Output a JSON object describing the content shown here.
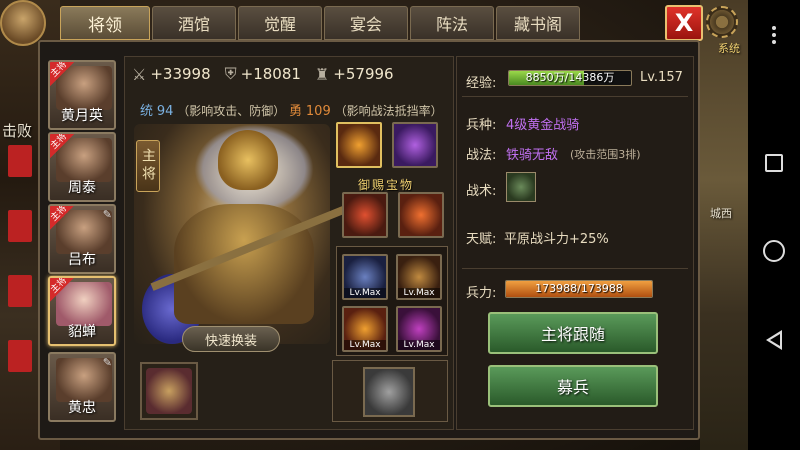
{
  "tabs": [
    {
      "label": "将领",
      "active": true
    },
    {
      "label": "酒馆",
      "active": false
    },
    {
      "label": "觉醒",
      "active": false
    },
    {
      "label": "宴会",
      "active": false
    },
    {
      "label": "阵法",
      "active": false
    },
    {
      "label": "藏书阁",
      "active": false
    }
  ],
  "close_label": "X",
  "background_text": {
    "defeat": "击败",
    "city_west": "城西",
    "corner": "系统"
  },
  "roster": [
    {
      "name": "黄月英",
      "badge": "主将",
      "selected": false
    },
    {
      "name": "周泰",
      "badge": "主将",
      "selected": false
    },
    {
      "name": "吕布",
      "badge": "主将",
      "selected": false
    },
    {
      "name": "貂蝉",
      "badge": "主将",
      "selected": true
    },
    {
      "name": "黄忠",
      "badge": "",
      "selected": false
    }
  ],
  "stats": {
    "attack": "+33998",
    "defense": "+18081",
    "troops": "+57996",
    "tong_label": "统",
    "tong_value": "94",
    "tong_desc": "（影响攻击、防御）",
    "yong_label": "勇",
    "yong_value": "109",
    "yong_desc": "（影响战法抵挡率）"
  },
  "hero": {
    "main_general_button": "主将",
    "quick_swap_button": "快速换装",
    "imperial_label": "御赐宝物",
    "equipment_level_label": "Lv.Max"
  },
  "info": {
    "exp_label": "经验:",
    "exp_text": "8850万/14386万",
    "exp_fraction": 0.615,
    "level": "Lv.157",
    "troop_type_label": "兵种:",
    "troop_type_value": "4级黄金战骑",
    "tactic_label": "战法:",
    "tactic_value": "铁骑无敌",
    "tactic_range": "(攻击范围3排)",
    "skill_label": "战术:",
    "talent_label": "天赋:",
    "talent_value": "平原战斗力+25%",
    "troop_label": "兵力:",
    "troop_text": "173988/173988",
    "troop_fraction": 1.0
  },
  "buttons": {
    "follow": "主将跟随",
    "recruit": "募兵"
  }
}
